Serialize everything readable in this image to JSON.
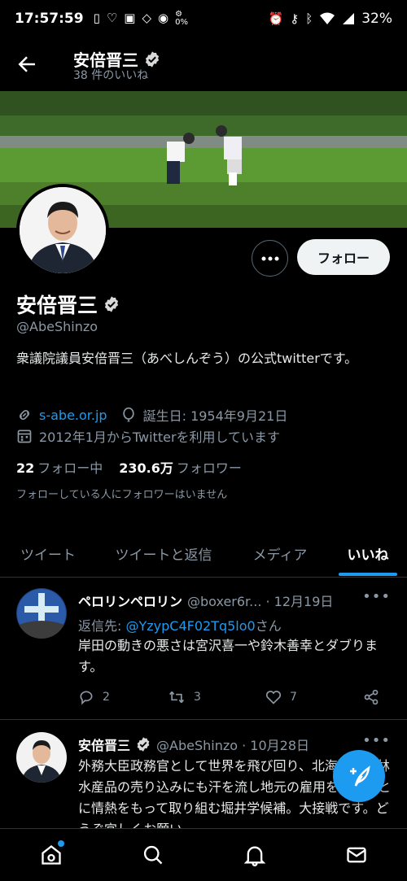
{
  "status_bar": {
    "time": "17:57:59",
    "battery": "32%",
    "data_speed": "0%"
  },
  "header": {
    "title": "安倍晋三",
    "subtitle": "38 件のいいね"
  },
  "profile": {
    "name": "安倍晋三",
    "handle": "@AbeShinzo",
    "bio": "衆議院議員安倍晋三（あべしんぞう）の公式twitterです。",
    "website": "s-abe.or.jp",
    "birthday": "誕生日: 1954年9月21日",
    "joined": "2012年1月からTwitterを利用しています",
    "following_count": "22",
    "following_label": "フォロー中",
    "followers_count": "230.6万",
    "followers_label": "フォロワー",
    "mutual_note": "フォローしている人にフォロワーはいません",
    "follow_button": "フォロー"
  },
  "tabs": [
    {
      "label": "ツイート"
    },
    {
      "label": "ツイートと返信"
    },
    {
      "label": "メディア"
    },
    {
      "label": "いいね"
    }
  ],
  "tweets": [
    {
      "name": "ペロリンペロリン",
      "handle_date": "@boxer6r... · 12月19日",
      "reply_to": "返信先: ",
      "reply_handle": "@YzypC4F02Tq5lo0",
      "reply_suffix": "さん",
      "text": "岸田の動きの悪さは宮沢喜一や鈴木善幸とダブります。",
      "replies": "2",
      "retweets": "3",
      "likes": "7"
    },
    {
      "name": "安倍晋三",
      "handle_date": "@AbeShinzo · 10月28日",
      "text": "外務大臣政務官として世界を飛び回り、北海道の農林水産品の売り込みにも汗を流し地元の雇用を守ることに情熱をもって取り組む堀井学候補。大接戦です。どうぞ宜しくお願い"
    }
  ],
  "colors": {
    "accent": "#1d9bf0",
    "background": "#000000",
    "muted": "#8b98a5"
  }
}
